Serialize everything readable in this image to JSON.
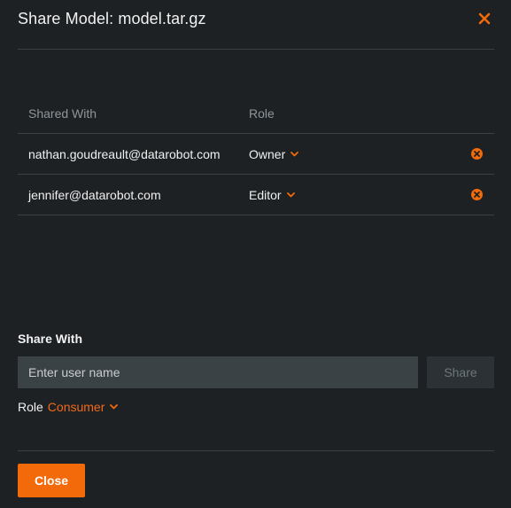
{
  "dialog": {
    "title": "Share Model: model.tar.gz"
  },
  "table": {
    "headers": {
      "shared_with": "Shared With",
      "role": "Role"
    },
    "rows": [
      {
        "email": "nathan.goudreault@datarobot.com",
        "role": "Owner"
      },
      {
        "email": "jennifer@datarobot.com",
        "role": "Editor"
      }
    ]
  },
  "share_form": {
    "label": "Share With",
    "input_value": "",
    "input_placeholder": "Enter user name",
    "share_button": "Share",
    "role_label": "Role",
    "role_value": "Consumer"
  },
  "footer": {
    "close_button": "Close"
  },
  "icons": {
    "close": "close-icon",
    "chevron": "chevron-down-icon",
    "remove": "remove-circle-icon"
  },
  "colors": {
    "background": "#1d2124",
    "accent": "#f26a0a",
    "divider": "#3a4044",
    "input_bg": "#3b4246",
    "muted_text": "#8e969b"
  }
}
